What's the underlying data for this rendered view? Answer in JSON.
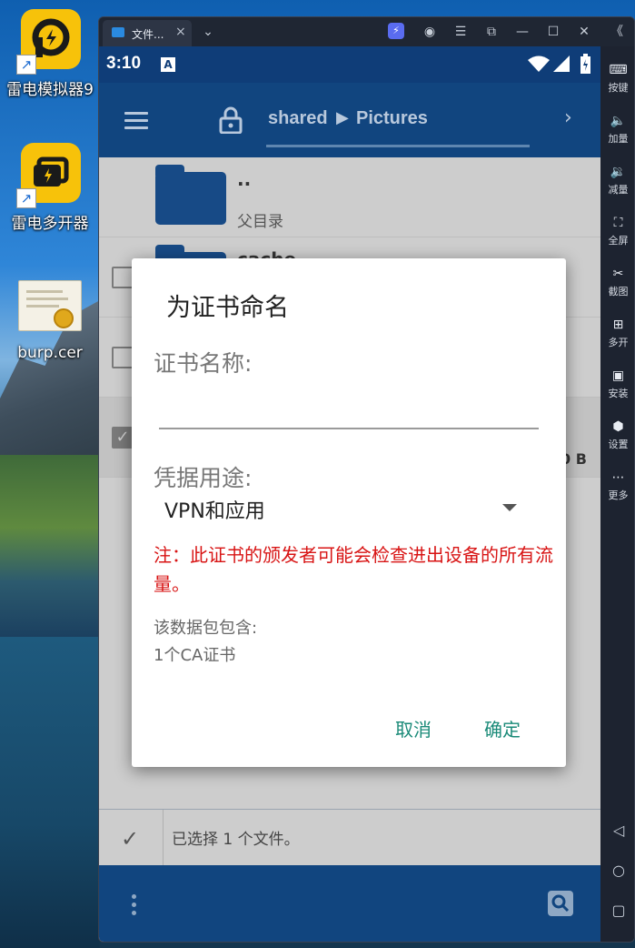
{
  "desktop": {
    "icons": [
      {
        "label": "雷电模拟器9"
      },
      {
        "label": "雷电多开器"
      },
      {
        "label": "burp.cer"
      }
    ]
  },
  "window": {
    "tab_title": "文件...",
    "tab_close": "×",
    "tab_dropdown": "⌄",
    "controls": [
      "☰",
      "⧉",
      "—",
      "☐",
      "✕",
      "《"
    ]
  },
  "statusbar": {
    "time": "3:10",
    "a_icon": "A"
  },
  "appbar": {
    "crumb_root": "shared",
    "crumb_sep": "▶",
    "crumb_current": "Pictures",
    "forward": "›"
  },
  "list": {
    "rows": [
      {
        "name": "..",
        "sub": "父目录"
      },
      {
        "name": "cache",
        "sub": ""
      }
    ],
    "size_fragment": "0 B"
  },
  "dialog": {
    "title": "为证书命名",
    "name_label": "证书名称:",
    "name_value": "",
    "usage_label": "凭据用途:",
    "usage_value": "VPN和应用",
    "warning": "注：此证书的颁发者可能会检查进出设备的所有流量。",
    "package_line1": "该数据包包含:",
    "package_line2": "1个CA证书",
    "cancel_label": "取消",
    "ok_label": "确定"
  },
  "selection": {
    "check": "✓",
    "text": "已选择 1 个文件。"
  },
  "sidebar": {
    "items": [
      {
        "icon": "⌨",
        "label": "按键"
      },
      {
        "icon": "🔈",
        "label": "加量"
      },
      {
        "icon": "🔉",
        "label": "减量"
      },
      {
        "icon": "⛶",
        "label": "全屏"
      },
      {
        "icon": "✂",
        "label": "截图"
      },
      {
        "icon": "⊞",
        "label": "多开"
      },
      {
        "icon": "▣",
        "label": "安装"
      },
      {
        "icon": "⬢",
        "label": "设置"
      },
      {
        "icon": "⋯",
        "label": "更多"
      }
    ],
    "nav": [
      "◁",
      "○",
      "▢"
    ]
  },
  "colors": {
    "appbar": "#11457f",
    "accent_button": "#1a8a78",
    "warning": "#d81414"
  }
}
